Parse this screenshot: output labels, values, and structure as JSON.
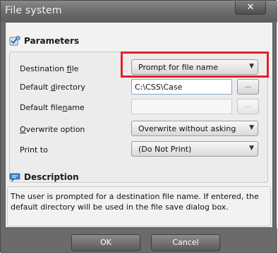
{
  "window": {
    "title": "File system",
    "close_label": "✕"
  },
  "parameters": {
    "heading": "Parameters",
    "destination_file": {
      "label_pre": "Destination ",
      "label_ul": "f",
      "label_post": "ile",
      "value": "Prompt for file name"
    },
    "default_directory": {
      "label_pre": "Default ",
      "label_ul": "d",
      "label_post": "irectory",
      "value": "C:\\CSS\\Case",
      "browse_label": "..."
    },
    "default_filename": {
      "label_pre": "Default file",
      "label_ul": "n",
      "label_post": "ame",
      "value": "",
      "browse_label": "..."
    },
    "overwrite_option": {
      "label_pre": "",
      "label_ul": "O",
      "label_post": "verwrite option",
      "value": "Overwrite without asking"
    },
    "print_to": {
      "label_pre": "Print to",
      "label_ul": "",
      "label_post": "",
      "value": "(Do Not Print)"
    }
  },
  "description": {
    "heading": "Description",
    "text": "The user is prompted for a destination file name. If entered, the default directory will be used in the file save dialog box."
  },
  "footer": {
    "ok_label": "OK",
    "cancel_label": "Cancel"
  },
  "colors": {
    "highlight": "#e4202a",
    "frame": "#6b6b6b",
    "panel": "#f2f2f2"
  }
}
